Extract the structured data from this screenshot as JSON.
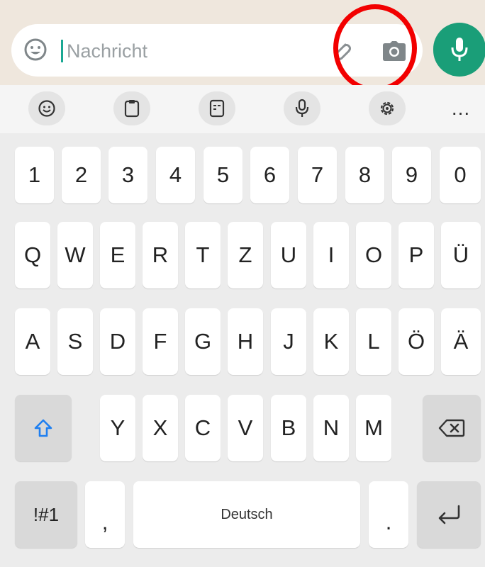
{
  "chat": {
    "placeholder": "Nachricht",
    "icons": {
      "emoji": "emoji-icon",
      "attach": "paperclip-icon",
      "camera": "camera-icon",
      "mic": "microphone-icon"
    },
    "accent_color": "#1a9e78",
    "highlight_color": "#f20000"
  },
  "toolbar": {
    "items": [
      {
        "icon": "emoji-icon"
      },
      {
        "icon": "clipboard-icon"
      },
      {
        "icon": "sticker-icon"
      },
      {
        "icon": "microphone-icon"
      },
      {
        "icon": "gear-icon"
      }
    ],
    "more_label": "..."
  },
  "keyboard": {
    "row_numbers": [
      "1",
      "2",
      "3",
      "4",
      "5",
      "6",
      "7",
      "8",
      "9",
      "0"
    ],
    "row_q": [
      "Q",
      "W",
      "E",
      "R",
      "T",
      "Z",
      "U",
      "I",
      "O",
      "P",
      "Ü"
    ],
    "row_a": [
      "A",
      "S",
      "D",
      "F",
      "G",
      "H",
      "J",
      "K",
      "L",
      "Ö",
      "Ä"
    ],
    "row_y": [
      "Y",
      "X",
      "C",
      "V",
      "B",
      "N",
      "M"
    ],
    "symbols_label": "!#1",
    "comma_label": ",",
    "space_label": "Deutsch",
    "period_label": ".",
    "shift_icon": "shift-icon",
    "backspace_icon": "backspace-icon",
    "enter_icon": "enter-icon",
    "shift_color": "#1f7ff0"
  }
}
